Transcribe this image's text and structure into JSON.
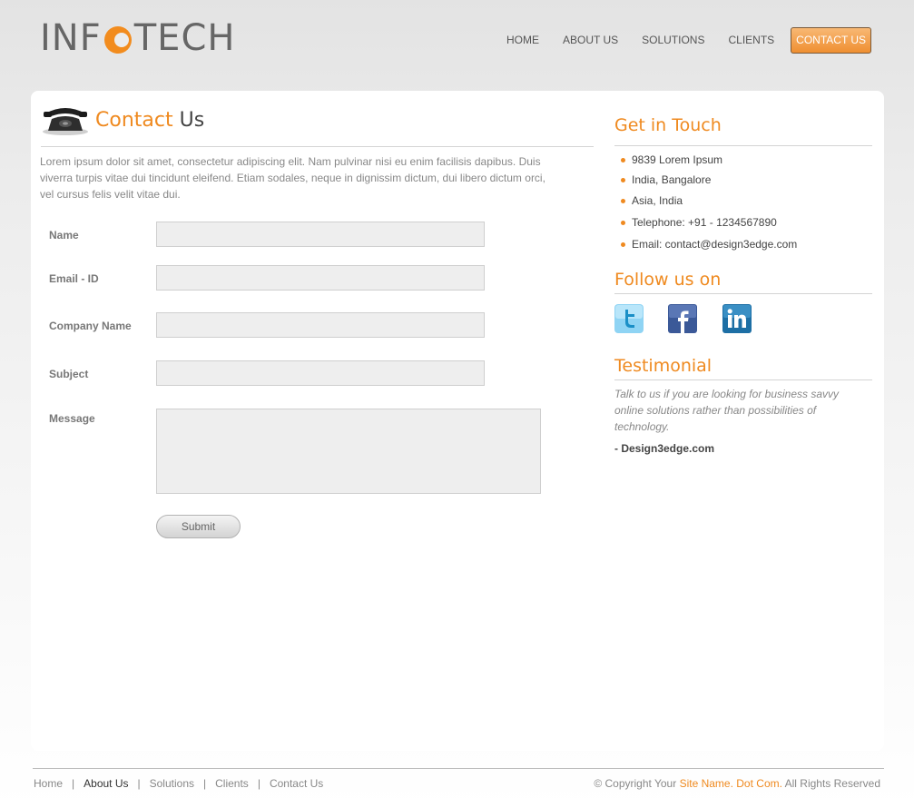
{
  "header": {
    "logo_left": "INF",
    "logo_right": "TECH",
    "nav": [
      "HOME",
      "ABOUT US",
      "SOLUTIONS",
      "CLIENTS",
      "CONTACT US"
    ]
  },
  "main": {
    "title_accent": "Contact",
    "title_rest": "Us",
    "intro": "Lorem ipsum dolor sit amet, consectetur adipiscing elit. Nam pulvinar nisi eu enim facilisis dapibus. Duis viverra turpis vitae dui tincidunt eleifend. Etiam sodales, neque in dignissim dictum, dui libero dictum orci, vel cursus felis velit vitae dui.",
    "form": {
      "name_label": "Name",
      "email_label": "Email - ID",
      "company_label": "Company Name",
      "subject_label": "Subject",
      "message_label": "Message",
      "submit_label": "Submit"
    }
  },
  "sidebar": {
    "get_in_touch": "Get in Touch",
    "contact_items": [
      "9839 Lorem Ipsum",
      "India, Bangalore",
      "Asia, India",
      "Telephone: +91 - 1234567890",
      "Email: contact@design3edge.com"
    ],
    "follow_us": "Follow us on",
    "social": [
      "twitter-icon",
      "facebook-icon",
      "linkedin-icon"
    ],
    "testimonial_heading": "Testimonial",
    "testimonial_text": "Talk to us if you are looking for business savvy online solutions rather than possibilities of technology.",
    "testimonial_author": "- Design3edge.com"
  },
  "footer": {
    "links": [
      "Home",
      "About Us",
      "Solutions",
      "Clients",
      "Contact Us"
    ],
    "separator": "|",
    "copyright_pre": "© Copyright Your",
    "copyright_site": "Site Name. Dot Com.",
    "copyright_post": "All Rights Reserved"
  },
  "colors": {
    "accent": "#ef8a20",
    "text": "#555555",
    "panel": "#ffffff"
  }
}
